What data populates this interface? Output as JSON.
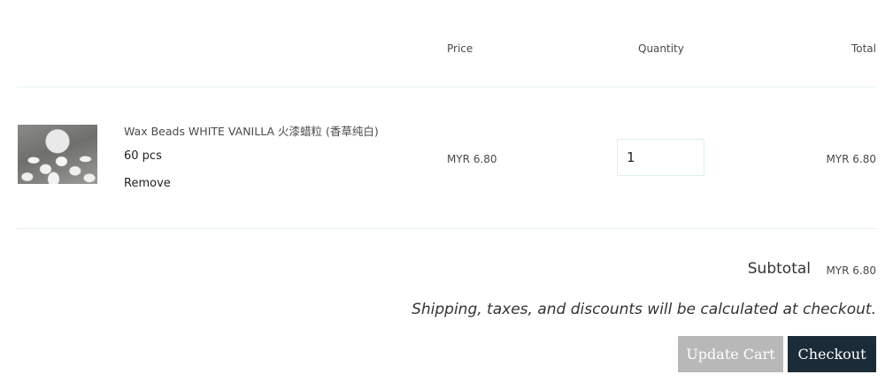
{
  "table": {
    "headers": {
      "price": "Price",
      "quantity": "Quantity",
      "total": "Total"
    }
  },
  "item": {
    "title": "Wax Beads WHITE VANILLA 火漆蜡粒 (香草纯白)",
    "variant": "60 pcs",
    "remove_label": "Remove",
    "price": "MYR 6.80",
    "quantity": "1",
    "line_total": "MYR 6.80"
  },
  "summary": {
    "subtotal_label": "Subtotal",
    "subtotal_value": "MYR 6.80",
    "shipping_note": "Shipping, taxes, and discounts will be calculated at checkout."
  },
  "actions": {
    "update_label": "Update Cart",
    "checkout_label": "Checkout"
  },
  "colors": {
    "checkout_button": "#1b2b38",
    "update_button": "#b8b8b8",
    "divider": "#e6f3f3"
  }
}
